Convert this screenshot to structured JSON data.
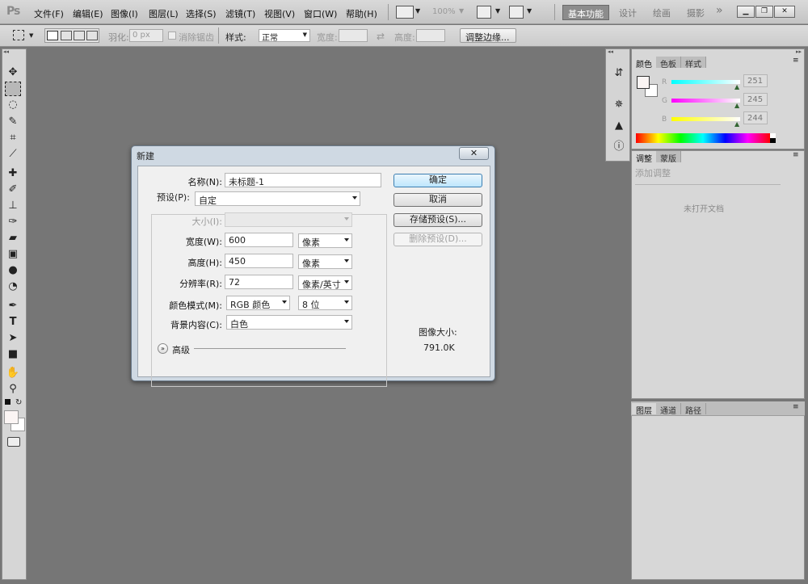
{
  "app": {
    "logo": "Ps"
  },
  "menu": [
    "文件(F)",
    "编辑(E)",
    "图像(I)",
    "图层(L)",
    "选择(S)",
    "滤镜(T)",
    "视图(V)",
    "窗口(W)",
    "帮助(H)"
  ],
  "menubar": {
    "zoom": "100%"
  },
  "workspaces": {
    "active": "基本功能",
    "items": [
      "设计",
      "绘画",
      "摄影"
    ],
    "more": "»"
  },
  "options": {
    "feather_label": "羽化:",
    "feather_value": "0 px",
    "antialias_label": "消除锯齿",
    "style_label": "样式:",
    "style_value": "正常",
    "width_label": "宽度:",
    "height_label": "高度:",
    "refine_button": "调整边缘..."
  },
  "panels": {
    "color_tabs": [
      "颜色",
      "色板",
      "样式"
    ],
    "color": {
      "r_label": "R",
      "g_label": "G",
      "b_label": "B",
      "r": "251",
      "g": "245",
      "b": "244"
    },
    "adjust_tabs": [
      "调整",
      "蒙版"
    ],
    "adjust_title": "添加调整",
    "adjust_empty": "未打开文档",
    "layers_tabs": [
      "图层",
      "通道",
      "路径"
    ]
  },
  "dialog": {
    "title": "新建",
    "close": "✕",
    "name_label": "名称(N):",
    "name_value": "未标题-1",
    "preset_label": "预设(P):",
    "preset_value": "自定",
    "size_label": "大小(I):",
    "width_label": "宽度(W):",
    "width_value": "600",
    "width_unit": "像素",
    "height_label": "高度(H):",
    "height_value": "450",
    "height_unit": "像素",
    "resolution_label": "分辨率(R):",
    "resolution_value": "72",
    "resolution_unit": "像素/英寸",
    "mode_label": "颜色模式(M):",
    "mode_value": "RGB 颜色",
    "mode_bits": "8 位",
    "bg_label": "背景内容(C):",
    "bg_value": "白色",
    "advanced_label": "高级",
    "ok": "确定",
    "cancel": "取消",
    "save_preset": "存储预设(S)...",
    "delete_preset": "删除预设(D)...",
    "image_size_label": "图像大小:",
    "image_size_value": "791.0K"
  },
  "colors": {
    "accent": "#3c7fb1",
    "workspace_bg": "#767676"
  }
}
